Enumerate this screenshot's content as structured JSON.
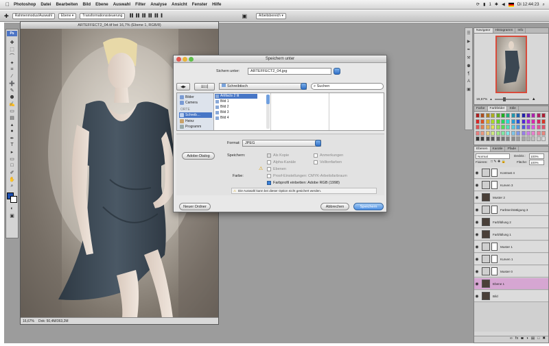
{
  "menubar": {
    "app": "Photoshop",
    "items": [
      "Datei",
      "Bearbeiten",
      "Bild",
      "Ebene",
      "Auswahl",
      "Filter",
      "Analyse",
      "Ansicht",
      "Fenster",
      "Hilfe"
    ],
    "clock": "Di 12:44:23",
    "battery": "1",
    "colors": {
      "bar": "#dcdcdc"
    }
  },
  "options": {
    "select_label": "Rahmenmodus/Auswahl",
    "select_value": "Ebene",
    "checkbox_label": "Transformationssteuerung",
    "workspace": "Arbeitsbereich"
  },
  "document": {
    "title": "ARTEFFECT2_04.tif bei 16,7% (Ebene 1, RGB/8)",
    "zoom": "16,67%",
    "doc_size": "Dok: 50,4M/363,2M"
  },
  "dialog": {
    "title": "Speichern unter",
    "save_as_label": "Sichern unter:",
    "filename": "ARTEFFECT2_04.jpg",
    "location": "Schreibtisch",
    "search_placeholder": "Suchen",
    "sidebar": [
      {
        "label": "Bilder"
      },
      {
        "label": "Camera"
      },
      {
        "label": "ORTE"
      },
      {
        "label": "Schreib…"
      },
      {
        "label": "Heinz"
      },
      {
        "label": "Programm"
      }
    ],
    "column1": [
      "Artifacts 2 lit",
      "Bild 1",
      "Bild 2",
      "Bild 3",
      "Bild 4"
    ],
    "format_label": "Format:",
    "format_value": "JPEG",
    "adobe_dialog_button": "Adobe-Dialog",
    "save_label": "Speichern:",
    "opt_copy": "Als Kopie",
    "opt_annotations": "Anmerkungen",
    "opt_alpha": "Alpha-Kanäle",
    "opt_spot": "Volltonfarben",
    "opt_layers": "Ebenen",
    "color_label": "Farbe:",
    "opt_proof": "Proof-Einstellungen: CMYK-Arbeitsfarbraum",
    "opt_icc": "Farbprofil einbetten: Adobe RGB (1998)",
    "warning": "Die Auswahl kann bei dieser Option nicht gesichert werden.",
    "new_folder": "Neuer Ordner",
    "cancel": "Abbrechen",
    "save": "Speichern"
  },
  "navigator": {
    "tabs": [
      "Navigator",
      "Histogramm",
      "Info"
    ],
    "zoom": "16,67%"
  },
  "swatches": {
    "tabs": [
      "Farbe",
      "Farbfelder",
      "Stile"
    ]
  },
  "layers": {
    "tabs": [
      "Ebenen",
      "Kanäle",
      "Pfade"
    ],
    "blend_mode": "Normal",
    "opacity_label": "Deckkr.:",
    "opacity": "100%",
    "lock_label": "Fixieren:",
    "fill_label": "Fläche:",
    "fill": "100%",
    "rows": [
      {
        "name": "Kontrast 4",
        "kind": "adj",
        "selected": false
      },
      {
        "name": "Kurven 3",
        "kind": "adj",
        "selected": false
      },
      {
        "name": "Muster 2",
        "kind": "pix",
        "selected": false
      },
      {
        "name": "Farbton/Sättigung 3",
        "kind": "adj",
        "selected": false
      },
      {
        "name": "Farbfüllung 2",
        "kind": "pix",
        "selected": false
      },
      {
        "name": "Farbfüllung 1",
        "kind": "pix",
        "selected": false
      },
      {
        "name": "Muster 1",
        "kind": "adj",
        "selected": false
      },
      {
        "name": "Kurven 1",
        "kind": "adj",
        "selected": false
      },
      {
        "name": "Muster 0",
        "kind": "adj",
        "selected": false
      },
      {
        "name": "Ebene 1",
        "kind": "pix",
        "selected": true
      },
      {
        "name": "Bild",
        "kind": "pix",
        "selected": false
      }
    ]
  },
  "colors": {
    "accent": "#3b7fd6",
    "selected_layer": "#d6a6d2",
    "workspace": "#9c9c9c",
    "dress": "#3e4a55"
  }
}
